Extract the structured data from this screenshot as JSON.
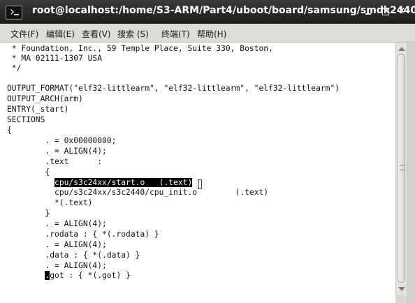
{
  "window": {
    "title": "root@localhost:/home/S3-ARM/Part4/uboot/board/samsung/smdk2440",
    "close_glyph": "×"
  },
  "menubar": {
    "items": [
      {
        "label": "文件(F)"
      },
      {
        "label": "编辑(E)"
      },
      {
        "label": "查看(V)"
      },
      {
        "label": "搜索 (S)"
      },
      {
        "label": "终端(T)"
      },
      {
        "label": "帮助(H)"
      }
    ]
  },
  "terminal": {
    "lines": [
      " * Foundation, Inc., 59 Temple Place, Suite 330, Boston,",
      " * MA 02111-1307 USA",
      " */",
      "",
      "OUTPUT_FORMAT(\"elf32-littlearm\", \"elf32-littlearm\", \"elf32-littlearm\")",
      "OUTPUT_ARCH(arm)",
      "ENTRY(_start)",
      "SECTIONS",
      "{",
      "        . = 0x00000000;",
      "        . = ALIGN(4);",
      "        .text      :",
      "        {",
      "          ",
      "          cpu/s3c24xx/s3c2440/cpu_init.o        (.text)",
      "          *(.text)",
      "        }",
      "        . = ALIGN(4);",
      "        .rodata : { *(.rodata) }",
      "        . = ALIGN(4);",
      "        .data : { *(.data) }",
      "        . = ALIGN(4);",
      "        ",
      ""
    ],
    "selected_text": "cpu/s3c24xx/start.o   (.text)",
    "cursor_char": ".",
    "cursor_line_rest": "got : { *(.got) }"
  },
  "icons": {
    "terminal": "terminal-icon",
    "minimize": "minimize-icon",
    "maximize": "maximize-icon",
    "close": "close-icon",
    "scroll_up": "arrow-up-icon",
    "scroll_down": "arrow-down-icon"
  },
  "colors": {
    "titlebar": "#1c1c1c",
    "terminal_bg": "#ffffff",
    "terminal_fg": "#111111",
    "selection_bg": "#000000",
    "selection_fg": "#ffffff"
  }
}
